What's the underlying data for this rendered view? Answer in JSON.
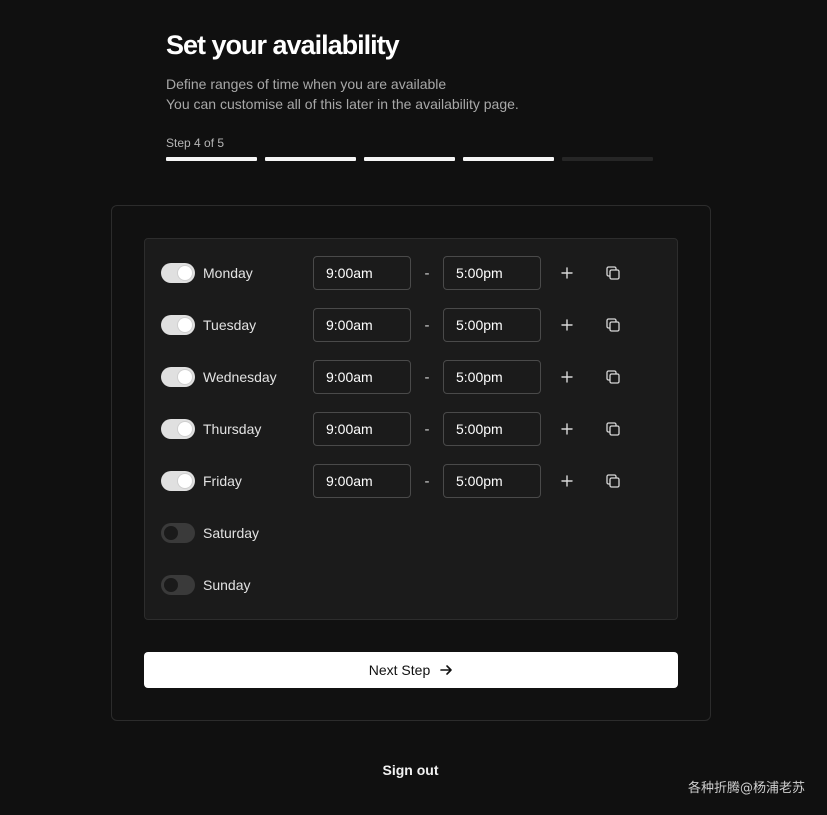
{
  "header": {
    "title": "Set your availability",
    "subtitle_line1": "Define ranges of time when you are available",
    "subtitle_line2": "You can customise all of this later in the availability page.",
    "step_label": "Step 4 of 5",
    "step_current": 4,
    "step_total": 5
  },
  "schedule": {
    "days": [
      {
        "name": "Monday",
        "enabled": true,
        "start": "9:00am",
        "end": "5:00pm"
      },
      {
        "name": "Tuesday",
        "enabled": true,
        "start": "9:00am",
        "end": "5:00pm"
      },
      {
        "name": "Wednesday",
        "enabled": true,
        "start": "9:00am",
        "end": "5:00pm"
      },
      {
        "name": "Thursday",
        "enabled": true,
        "start": "9:00am",
        "end": "5:00pm"
      },
      {
        "name": "Friday",
        "enabled": true,
        "start": "9:00am",
        "end": "5:00pm"
      },
      {
        "name": "Saturday",
        "enabled": false
      },
      {
        "name": "Sunday",
        "enabled": false
      }
    ],
    "separator": "-",
    "add_icon": "plus-icon",
    "copy_icon": "copy-icon"
  },
  "actions": {
    "next_label": "Next Step",
    "next_icon": "arrow-right-icon",
    "signout_label": "Sign out"
  },
  "watermark": "各种折腾@杨浦老苏"
}
